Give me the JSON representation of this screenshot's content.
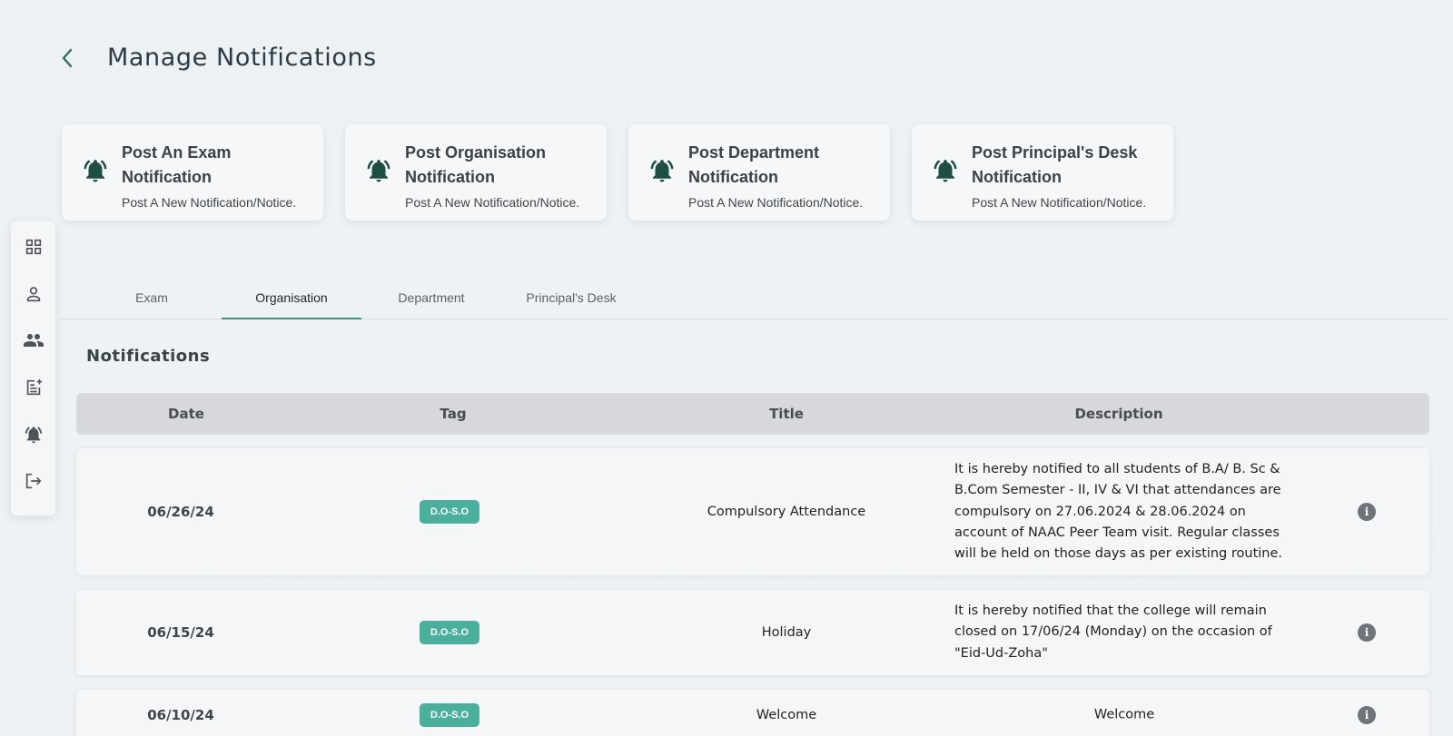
{
  "header": {
    "title": "Manage Notifications"
  },
  "cards": [
    {
      "title_line1": "Post An Exam",
      "title_line2": "Notification",
      "subtitle": "Post A New Notification/Notice."
    },
    {
      "title_line1": "Post Organisation",
      "title_line2": "Notification",
      "subtitle": "Post A New Notification/Notice."
    },
    {
      "title_line1": "Post Department",
      "title_line2": "Notification",
      "subtitle": "Post A New Notification/Notice."
    },
    {
      "title_line1": "Post Principal's Desk",
      "title_line2": "Notification",
      "subtitle": "Post A New Notification/Notice."
    }
  ],
  "sidebar": {
    "items": [
      "grid-icon",
      "person-icon",
      "people-icon",
      "post-add-icon",
      "bell-icon",
      "logout-icon"
    ]
  },
  "tabs": [
    {
      "label": "Exam"
    },
    {
      "label": "Organisation",
      "active": true
    },
    {
      "label": "Department"
    },
    {
      "label": "Principal's Desk"
    }
  ],
  "section": {
    "title": "Notifications"
  },
  "table": {
    "headers": {
      "date": "Date",
      "tag": "Tag",
      "title": "Title",
      "description": "Description"
    },
    "rows": [
      {
        "date": "06/26/24",
        "tag": "D.O-S.O",
        "title": "Compulsory Attendance",
        "description": "It is hereby notified to all students of B.A/ B. Sc & B.Com Semester - II, IV & VI that attendances are compulsory on 27.06.2024 & 28.06.2024 on account of NAAC Peer Team visit. Regular classes will be held on those days as per existing routine."
      },
      {
        "date": "06/15/24",
        "tag": "D.O-S.O",
        "title": "Holiday",
        "description": "It is hereby notified that the college will remain closed on 17/06/24 (Monday) on the occasion of \"Eid-Ud-Zoha\""
      },
      {
        "date": "06/10/24",
        "tag": "D.O-S.O",
        "title": "Welcome",
        "description": "Welcome"
      }
    ]
  },
  "colors": {
    "accent": "#3f8f80",
    "tag_bg": "#4aaf9c",
    "icon": "#1f4e45"
  }
}
